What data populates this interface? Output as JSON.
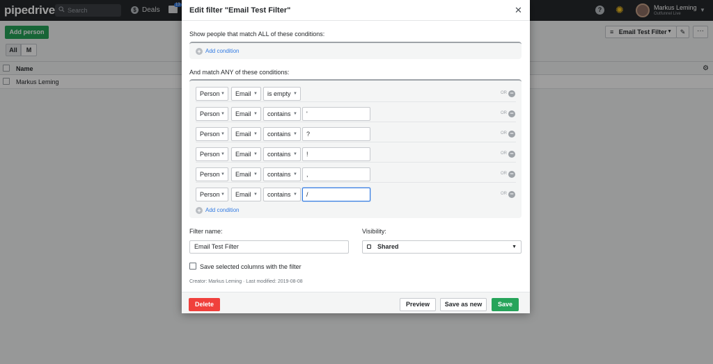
{
  "app": {
    "logo": "pipedrive",
    "search_placeholder": "Search",
    "nav_deals": "Deals",
    "mail_badge": "13",
    "user_name": "Markus Leming",
    "user_company": "Outfunnel Live"
  },
  "page": {
    "add_button": "Add person",
    "segments": [
      "All",
      "M"
    ],
    "filter_label": "Email Test Filter",
    "column_name": "Name",
    "rows": [
      "Markus Leming"
    ]
  },
  "modal": {
    "title": "Edit filter \"Email Test Filter\"",
    "all_label": "Show people that match ALL of these conditions:",
    "any_label": "And match ANY of these conditions:",
    "add_condition": "Add condition",
    "or_label": "OR",
    "conditions": [
      {
        "object": "Person",
        "field": "Email",
        "operator": "is empty",
        "value": null
      },
      {
        "object": "Person",
        "field": "Email",
        "operator": "contains",
        "value": "'"
      },
      {
        "object": "Person",
        "field": "Email",
        "operator": "contains",
        "value": "?"
      },
      {
        "object": "Person",
        "field": "Email",
        "operator": "contains",
        "value": "!"
      },
      {
        "object": "Person",
        "field": "Email",
        "operator": "contains",
        "value": ","
      },
      {
        "object": "Person",
        "field": "Email",
        "operator": "contains",
        "value": "/"
      }
    ],
    "filter_name_label": "Filter name:",
    "filter_name_value": "Email Test Filter",
    "visibility_label": "Visibility:",
    "visibility_value": "Shared",
    "save_columns_label": "Save selected columns with the filter",
    "meta": "Creator: Markus Leming · Last modified: 2019-08-08",
    "buttons": {
      "delete": "Delete",
      "preview": "Preview",
      "save_as_new": "Save as new",
      "save": "Save"
    }
  },
  "colors": {
    "topbar": "#26292c",
    "primary_green": "#26a45a",
    "danger_red": "#f0403c",
    "link_blue": "#317ae2"
  }
}
